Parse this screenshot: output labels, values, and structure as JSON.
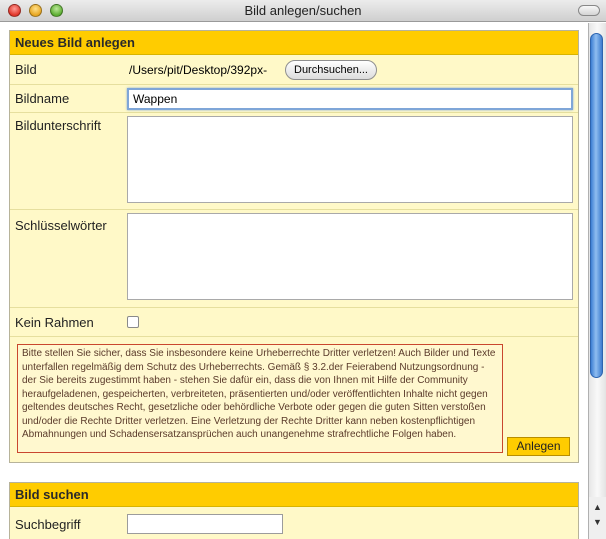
{
  "window": {
    "title": "Bild anlegen/suchen"
  },
  "new_image": {
    "section_title": "Neues Bild anlegen",
    "fields": {
      "bild_label": "Bild",
      "bild_path_value": "/Users/pit/Desktop/392px-",
      "browse_label": "Durchsuchen...",
      "bildname_label": "Bildname",
      "bildname_value": "Wappen",
      "bildunterschrift_label": "Bildunterschrift",
      "schluesselwoerter_label": "Schlüsselwörter",
      "kein_rahmen_label": "Kein Rahmen"
    },
    "notice_text": "Bitte stellen Sie sicher, dass Sie insbesondere keine Urheberrechte Dritter verletzen! Auch Bilder und Texte unterfallen regelmäßig dem Schutz des Urheberrechts. Gemäß § 3.2.der Feierabend Nutzungsordnung - der Sie bereits zugestimmt haben - stehen Sie dafür ein, dass die von Ihnen mit Hilfe der Community heraufgeladenen, gespeicherten, verbreiteten, präsentierten und/oder veröffentlichten Inhalte nicht gegen geltendes deutsches Recht, gesetzliche oder behördliche Verbote oder gegen die guten Sitten verstoßen und/oder die Rechte Dritter verletzen. Eine Verletzung der Rechte Dritter kann neben kostenpflichtigen Abmahnungen und Schadensersatzansprüchen auch unangenehme strafrechtliche Folgen haben.",
    "submit_label": "Anlegen"
  },
  "search": {
    "section_title": "Bild suchen",
    "suchbegriff_label": "Suchbegriff"
  },
  "colors": {
    "header_yellow": "#ffcc00",
    "panel_bg": "#fff9c8",
    "notice_border": "#c9472e",
    "scroll_thumb": "#3e7fd3"
  }
}
